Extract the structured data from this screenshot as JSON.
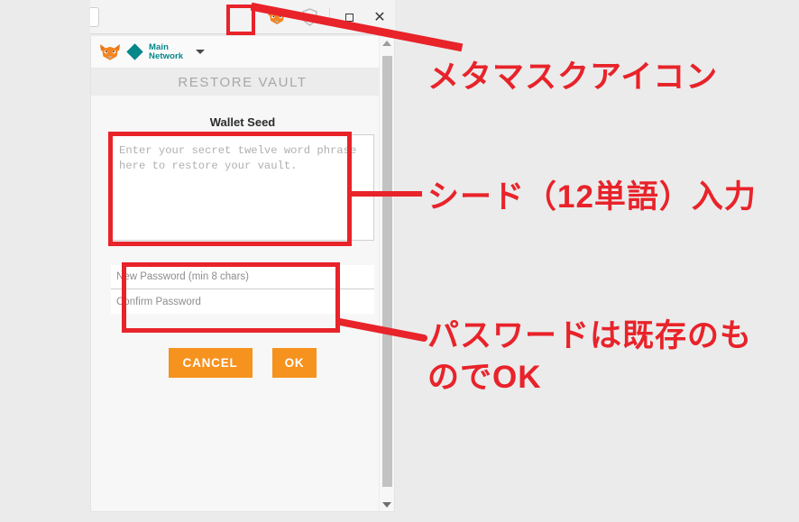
{
  "browser": {
    "toolbar": {
      "metamask_icon": "metamask-fox-icon",
      "brave_icon": "brave-lion-icon"
    },
    "window_controls": {
      "maximize": "maximize-icon",
      "close": "✕"
    }
  },
  "metamask": {
    "header": {
      "logo": "metamask-fox-icon",
      "network_name": "Main Network",
      "network_caret": "chevron-down-icon"
    },
    "title": "RESTORE VAULT",
    "seed": {
      "label": "Wallet Seed",
      "placeholder": "Enter your secret twelve word phrase here to restore your vault.",
      "value": ""
    },
    "password": {
      "new_placeholder": "New Password (min 8 chars)",
      "new_value": "",
      "confirm_placeholder": "Confirm Password",
      "confirm_value": ""
    },
    "buttons": {
      "cancel": "CANCEL",
      "ok": "OK"
    },
    "scrollbar": {
      "up": "scroll-up-arrow",
      "down": "scroll-down-arrow"
    }
  },
  "annotations": {
    "color": "#e8232a",
    "metamask_icon_note": "メタマスクアイコン",
    "seed_note": "シード（12単語）入力",
    "password_note": "パスワードは既存のものでOK"
  },
  "colors": {
    "button_orange": "#f6921e",
    "network_teal": "#038789",
    "annotation_red": "#e8232a"
  }
}
